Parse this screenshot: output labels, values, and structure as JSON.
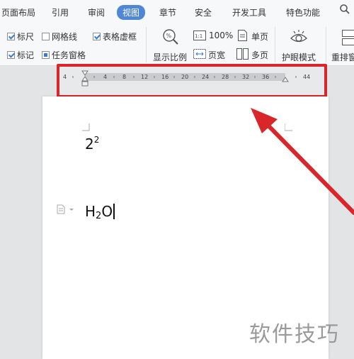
{
  "menubar": {
    "tabs": [
      {
        "label": "页面布局"
      },
      {
        "label": "引用"
      },
      {
        "label": "审阅"
      },
      {
        "label": "视图",
        "active": true
      },
      {
        "label": "章节"
      },
      {
        "label": "安全"
      },
      {
        "label": "开发工具"
      },
      {
        "label": "特色功能"
      }
    ],
    "active_color": "#4f87d6"
  },
  "ribbon": {
    "checkboxes": {
      "ruler": {
        "label": "标尺",
        "checked": true
      },
      "gridlines": {
        "label": "网格线",
        "checked": false
      },
      "table_gridlines": {
        "label": "表格虚框",
        "checked": true
      },
      "marks": {
        "label": "标记",
        "checked": true
      },
      "task_pane": {
        "label": "任务窗格",
        "checked": true
      }
    },
    "zoom_label": "显示比例",
    "zoom_100": "100%",
    "page_width": "页宽",
    "single_page": "单页",
    "multi_page": "多页",
    "eye_mode": "护眼模式",
    "rearrange": "重排窗"
  },
  "ruler": {
    "ticks": [
      "4",
      "4",
      "8",
      "12",
      "16",
      "20",
      "24",
      "28",
      "32",
      "36",
      "44"
    ]
  },
  "document": {
    "line1_base": "2",
    "line1_sup": "2",
    "line2_h": "H",
    "line2_sub": "2",
    "line2_o": "O"
  },
  "watermark": "软件技巧",
  "colors": {
    "highlight": "#d9262b",
    "arrow": "#d9262b"
  }
}
